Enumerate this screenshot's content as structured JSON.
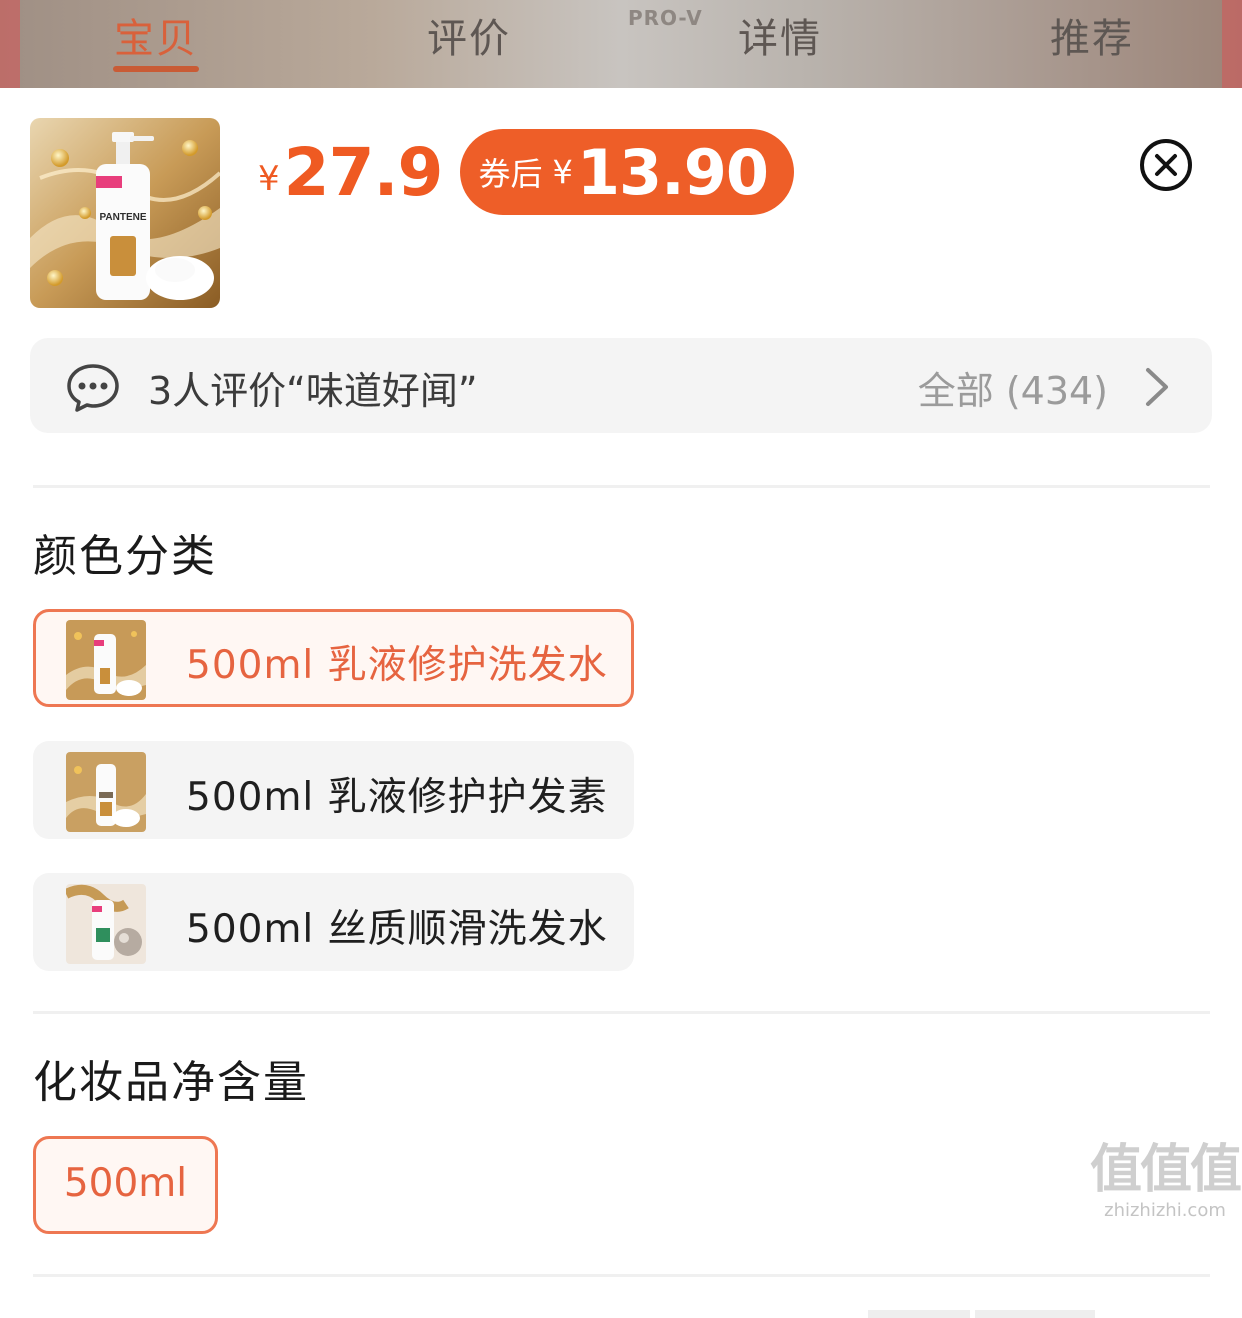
{
  "tabs": [
    {
      "label": "宝贝",
      "active": true
    },
    {
      "label": "评价",
      "active": false
    },
    {
      "label": "详情",
      "active": false
    },
    {
      "label": "推荐",
      "active": false
    }
  ],
  "backdrop_brand": "PRO-V",
  "product": {
    "image": "pantene-bottle-image",
    "bottle_brand": "PANTENE",
    "price_currency": "¥",
    "price": "27.9",
    "coupon_label": "券后",
    "coupon_currency": "¥",
    "coupon_price": "13.90"
  },
  "close_icon": "close-circle-icon",
  "reviews": {
    "icon": "chat-bubble-icon",
    "summary": "3人评价“味道好闻”",
    "all_label": "全部 (434)",
    "chevron_icon": "chevron-right-icon"
  },
  "color_section": {
    "title": "颜色分类",
    "options": [
      {
        "label": "500ml 乳液修护洗发水",
        "selected": true
      },
      {
        "label": "500ml 乳液修护护发素",
        "selected": false
      },
      {
        "label": "500ml 丝质顺滑洗发水",
        "selected": false
      }
    ]
  },
  "volume_section": {
    "title": "化妆品净含量",
    "options": [
      {
        "label": "500ml",
        "selected": true
      }
    ]
  },
  "watermark": {
    "big": "值值值",
    "small": "zhizhizhi.com"
  },
  "colors": {
    "accent": "#ef5a22",
    "selected_border": "#ee7752",
    "chip_bg": "#f4f4f4"
  }
}
